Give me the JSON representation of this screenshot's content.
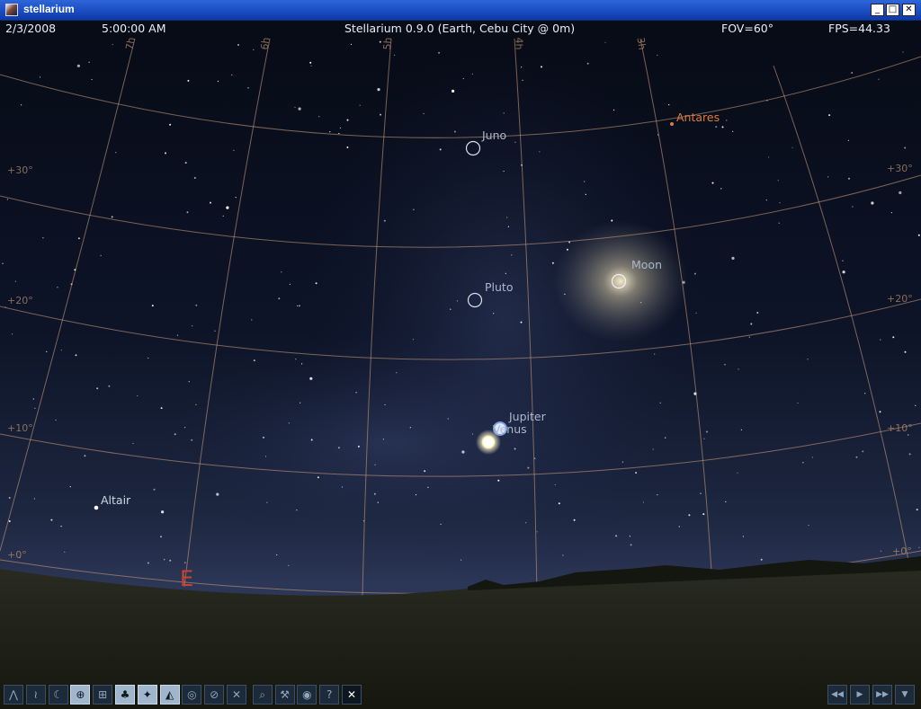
{
  "window": {
    "title": "stellarium",
    "minimize_glyph": "_",
    "maximize_glyph": "□",
    "close_glyph": "✕"
  },
  "info_bar": {
    "date": "2/3/2008",
    "time": "5:00:00 AM",
    "location": "Stellarium 0.9.0 (Earth, Cebu City @ 0m)",
    "fov": "FOV=60°",
    "fps": "FPS=44.33"
  },
  "sky_objects": [
    {
      "id": "juno",
      "label": "Juno",
      "color": "#aab8cc"
    },
    {
      "id": "antares",
      "label": "Antares",
      "color": "#e07a3c"
    },
    {
      "id": "moon",
      "label": "Moon",
      "color": "#aab8cc"
    },
    {
      "id": "pluto",
      "label": "Pluto",
      "color": "#aab8cc"
    },
    {
      "id": "jupiter",
      "label": "Jupiter",
      "color": "#aab8cc"
    },
    {
      "id": "venus",
      "label": "Venus",
      "color": "#aab8cc"
    },
    {
      "id": "altair",
      "label": "Altair",
      "color": "#cfd8e6"
    }
  ],
  "grid_labels": {
    "dec_30_left": "+30°",
    "dec_30_right": "+30°",
    "dec_20_left": "+20°",
    "dec_20_right": "+20°",
    "dec_10_left": "+10°",
    "dec_10_right": "+10°",
    "dec_0_left": "+0°",
    "dec_0_right": "+0°",
    "ra_7h": "7h",
    "ra_6h": "6h",
    "ra_5h": "5h",
    "ra_4h": "4h",
    "ra_3h": "3h"
  },
  "cardinal": {
    "east": "E"
  },
  "colors": {
    "grid_line": "#c89a78",
    "cardinal": "#c8432a",
    "sky_top": "#080c18",
    "horizon_glow": "#3b4a6e",
    "ground": "#22241c"
  },
  "toolbar": {
    "left_buttons": [
      {
        "name": "constellation-lines-icon",
        "glyph": "⋀",
        "active": false
      },
      {
        "name": "constellation-names-icon",
        "glyph": "≀",
        "active": false
      },
      {
        "name": "constellation-art-icon",
        "glyph": "☾",
        "active": false
      },
      {
        "name": "equatorial-grid-icon",
        "glyph": "⊕",
        "active": true
      },
      {
        "name": "azimuth-grid-icon",
        "glyph": "⊞",
        "active": false
      },
      {
        "name": "ground-icon",
        "glyph": "♣",
        "active": true
      },
      {
        "name": "cardinal-points-icon",
        "glyph": "✦",
        "active": true
      },
      {
        "name": "atmosphere-icon",
        "glyph": "◭",
        "active": true
      },
      {
        "name": "nebula-icon",
        "glyph": "◎",
        "active": false
      },
      {
        "name": "equatorial-mount-icon",
        "glyph": "⊘",
        "active": false
      },
      {
        "name": "center-object-icon",
        "glyph": "✕",
        "active": false
      },
      {
        "name": "search-icon",
        "glyph": "⌕",
        "active": false
      },
      {
        "name": "config-icon",
        "glyph": "⚒",
        "active": false
      },
      {
        "name": "night-mode-icon",
        "glyph": "◉",
        "active": false
      },
      {
        "name": "help-icon",
        "glyph": "?",
        "active": false
      },
      {
        "name": "quit-icon",
        "glyph": "✕",
        "active": false,
        "close": true
      }
    ],
    "right_buttons": [
      {
        "name": "rewind-icon",
        "glyph": "◀◀"
      },
      {
        "name": "play-icon",
        "glyph": "▶"
      },
      {
        "name": "fast-forward-icon",
        "glyph": "▶▶"
      },
      {
        "name": "real-time-icon",
        "glyph": "▼"
      }
    ]
  }
}
